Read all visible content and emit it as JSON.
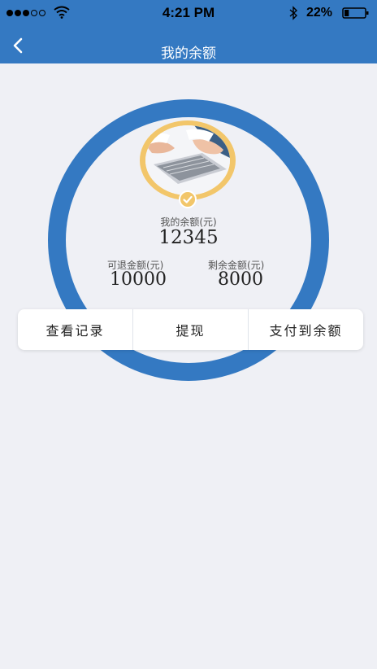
{
  "status_bar": {
    "time": "4:21 PM",
    "battery": "22%",
    "signal_icon": "signal-dots-icon",
    "wifi_icon": "wifi-icon",
    "bluetooth_icon": "bluetooth-icon",
    "battery_icon": "battery-icon",
    "battery_level": 0.22
  },
  "nav": {
    "title": "我的余额",
    "back_icon": "chevron-left-icon"
  },
  "balance": {
    "label": "我的余额(元)",
    "value": "12345",
    "refundable_label": "可退金额(元)",
    "refundable_value": "10000",
    "remaining_label": "剩余金额(元)",
    "remaining_value": "8000"
  },
  "actions": [
    {
      "label": "查看记录"
    },
    {
      "label": "提现"
    },
    {
      "label": "支付到余额"
    }
  ],
  "colors": {
    "primary": "#3479c2",
    "background": "#eff0f5",
    "avatar_ring": "#f2c66a"
  }
}
